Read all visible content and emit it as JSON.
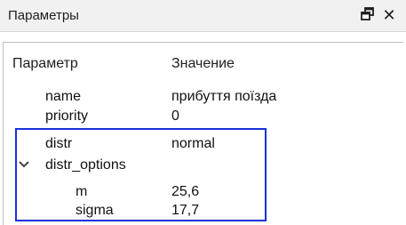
{
  "window": {
    "title": "Параметры",
    "float_icon": "float-window-icon",
    "close_icon": "close-icon",
    "close_glyph": "✕"
  },
  "table": {
    "headers": {
      "param": "Параметр",
      "value": "Значение"
    },
    "rows": [
      {
        "label": "name",
        "value": "прибуття поїзда"
      },
      {
        "label": "priority",
        "value": "0"
      },
      {
        "label": "distr",
        "value": "normal"
      },
      {
        "label": "distr_options",
        "value": "",
        "expanded": true
      },
      {
        "label": "m",
        "value": "25,6"
      },
      {
        "label": "sigma",
        "value": "17,7"
      }
    ]
  },
  "colors": {
    "highlight_border": "#1832d8",
    "titlebar_bg": "#f1f1f1"
  }
}
